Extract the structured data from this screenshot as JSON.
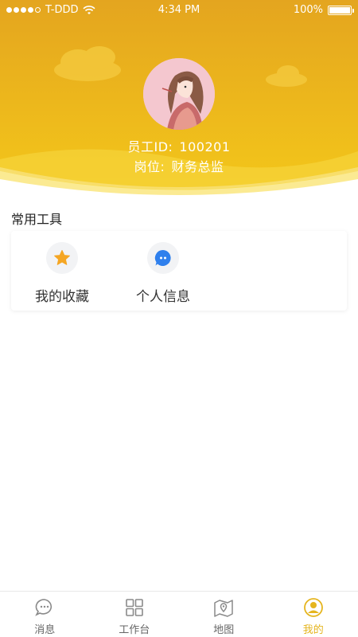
{
  "status_bar": {
    "carrier": "T-DDD",
    "time": "4:34 PM",
    "battery": "100%"
  },
  "profile": {
    "employee_id_label": "员工ID:",
    "employee_id": "100201",
    "position_label": "岗位:",
    "position": "财务总监"
  },
  "tools": {
    "section_title": "常用工具",
    "items": [
      {
        "label": "我的收藏",
        "icon": "star-icon"
      },
      {
        "label": "个人信息",
        "icon": "chat-icon"
      }
    ]
  },
  "tabbar": {
    "items": [
      {
        "label": "消息",
        "icon": "message-icon",
        "active": false
      },
      {
        "label": "工作台",
        "icon": "grid-icon",
        "active": false
      },
      {
        "label": "地图",
        "icon": "map-icon",
        "active": false
      },
      {
        "label": "我的",
        "icon": "user-icon",
        "active": true
      }
    ]
  },
  "colors": {
    "header_yellow": "#e7b31c",
    "accent": "#e5b51e",
    "star": "#f5a623",
    "chat": "#2f80ed"
  }
}
